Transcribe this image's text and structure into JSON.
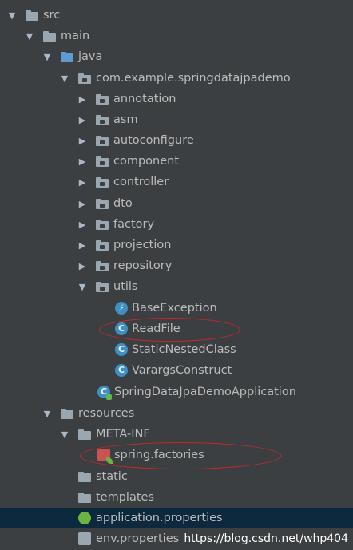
{
  "tree": {
    "src": "src",
    "main": "main",
    "java": "java",
    "package": "com.example.springdatajpademo",
    "annotation": "annotation",
    "asm": "asm",
    "autoconfigure": "autoconfigure",
    "component": "component",
    "controller": "controller",
    "dto": "dto",
    "factory": "factory",
    "projection": "projection",
    "repository": "repository",
    "utils": "utils",
    "base_exception": "BaseException",
    "read_file": "ReadFile",
    "static_nested": "StaticNestedClass",
    "varargs": "VarargsConstruct",
    "application_class": "SpringDataJpaDemoApplication",
    "resources": "resources",
    "meta_inf": "META-INF",
    "spring_factories": "spring.factories",
    "static": "static",
    "templates": "templates",
    "application_properties": "application.properties",
    "env_properties": "env.properties"
  },
  "watermark": "https://blog.csdn.net/whp404",
  "colors": {
    "background": "#3c3f41",
    "selection": "#0d293e",
    "annotation_ellipse": "#c62828",
    "text": "#bbbbbb"
  }
}
